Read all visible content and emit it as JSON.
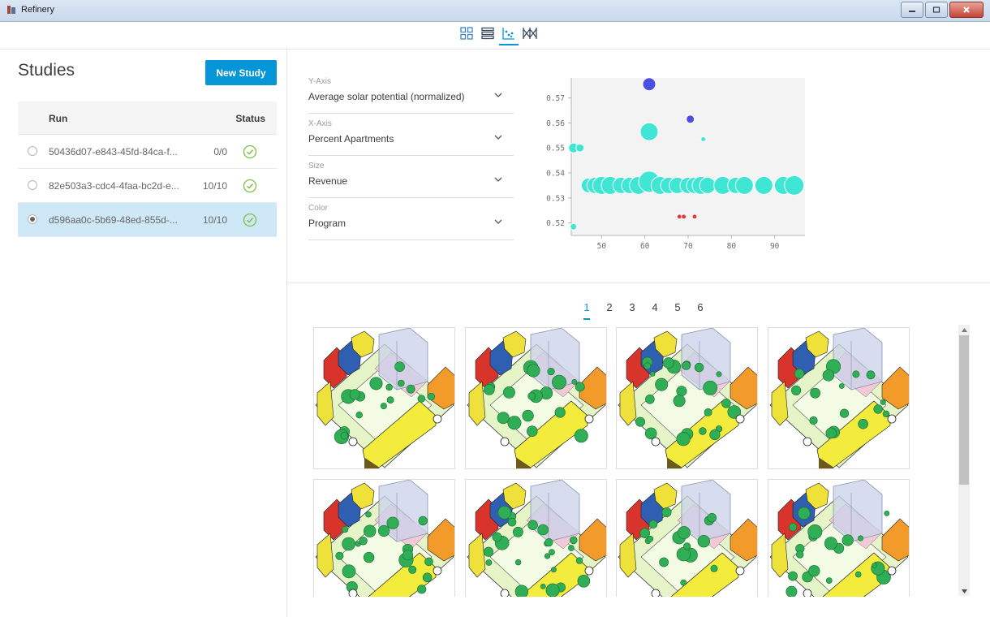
{
  "window": {
    "title": "Refinery",
    "controls": [
      "minimize",
      "maximize",
      "close"
    ]
  },
  "view_toolbar": {
    "buttons": [
      {
        "name": "grid-view-icon",
        "active": false
      },
      {
        "name": "list-view-icon",
        "active": false
      },
      {
        "name": "scatter-view-icon",
        "active": true
      },
      {
        "name": "parallel-coordinates-icon",
        "active": false
      }
    ]
  },
  "studies": {
    "title": "Studies",
    "new_study_label": "New Study",
    "columns": {
      "run": "Run",
      "status": "Status"
    },
    "rows": [
      {
        "id": "50436d07-e843-45fd-84ca-f...",
        "count": "0/0",
        "status": "complete",
        "selected": false
      },
      {
        "id": "82e503a3-cdc4-4faa-bc2d-e...",
        "count": "10/10",
        "status": "complete",
        "selected": false
      },
      {
        "id": "d596aa0c-5b69-48ed-855d-...",
        "count": "10/10",
        "status": "complete",
        "selected": true
      }
    ]
  },
  "axes": {
    "y": {
      "label": "Y-Axis",
      "value": "Average solar potential (normalized)"
    },
    "x": {
      "label": "X-Axis",
      "value": "Percent Apartments"
    },
    "size": {
      "label": "Size",
      "value": "Revenue"
    },
    "color": {
      "label": "Color",
      "value": "Program"
    }
  },
  "chart_data": {
    "type": "scatter",
    "title": "",
    "xlabel": "",
    "ylabel": "",
    "xlim": [
      43,
      97
    ],
    "ylim": [
      0.515,
      0.578
    ],
    "x_ticks": [
      50,
      60,
      70,
      80,
      90
    ],
    "y_ticks": [
      0.52,
      0.53,
      0.54,
      0.55,
      0.56,
      0.57
    ],
    "grid": false,
    "colors": {
      "teal": "#3ee6d3",
      "blue": "#4a4de6",
      "red": "#e8383d"
    },
    "points": [
      {
        "x": 61.0,
        "y": 0.5755,
        "size": 8,
        "color": "blue"
      },
      {
        "x": 70.5,
        "y": 0.5615,
        "size": 5,
        "color": "blue"
      },
      {
        "x": 61.0,
        "y": 0.5565,
        "size": 11,
        "color": "teal"
      },
      {
        "x": 73.5,
        "y": 0.5535,
        "size": 3,
        "color": "teal"
      },
      {
        "x": 43.5,
        "y": 0.55,
        "size": 6,
        "color": "teal"
      },
      {
        "x": 45.0,
        "y": 0.55,
        "size": 5,
        "color": "teal"
      },
      {
        "x": 43.5,
        "y": 0.5185,
        "size": 4,
        "color": "teal"
      },
      {
        "x": 68.0,
        "y": 0.5225,
        "size": 3,
        "color": "red"
      },
      {
        "x": 69.0,
        "y": 0.5225,
        "size": 3,
        "color": "red"
      },
      {
        "x": 71.5,
        "y": 0.5225,
        "size": 3,
        "color": "red"
      },
      {
        "x": 47.0,
        "y": 0.535,
        "size": 9,
        "color": "teal"
      },
      {
        "x": 48.5,
        "y": 0.535,
        "size": 10,
        "color": "teal"
      },
      {
        "x": 50.0,
        "y": 0.535,
        "size": 11,
        "color": "teal"
      },
      {
        "x": 52.0,
        "y": 0.535,
        "size": 11,
        "color": "teal"
      },
      {
        "x": 54.5,
        "y": 0.535,
        "size": 10,
        "color": "teal"
      },
      {
        "x": 56.5,
        "y": 0.535,
        "size": 10,
        "color": "teal"
      },
      {
        "x": 58.5,
        "y": 0.535,
        "size": 11,
        "color": "teal"
      },
      {
        "x": 61.0,
        "y": 0.5365,
        "size": 13,
        "color": "teal"
      },
      {
        "x": 63.5,
        "y": 0.535,
        "size": 11,
        "color": "teal"
      },
      {
        "x": 65.5,
        "y": 0.535,
        "size": 10,
        "color": "teal"
      },
      {
        "x": 67.5,
        "y": 0.535,
        "size": 10,
        "color": "teal"
      },
      {
        "x": 70.0,
        "y": 0.535,
        "size": 10,
        "color": "teal"
      },
      {
        "x": 71.5,
        "y": 0.535,
        "size": 10,
        "color": "teal"
      },
      {
        "x": 73.0,
        "y": 0.535,
        "size": 11,
        "color": "teal"
      },
      {
        "x": 74.5,
        "y": 0.535,
        "size": 10,
        "color": "teal"
      },
      {
        "x": 78.0,
        "y": 0.535,
        "size": 11,
        "color": "teal"
      },
      {
        "x": 81.0,
        "y": 0.535,
        "size": 10,
        "color": "teal"
      },
      {
        "x": 83.0,
        "y": 0.535,
        "size": 11,
        "color": "teal"
      },
      {
        "x": 87.5,
        "y": 0.535,
        "size": 11,
        "color": "teal"
      },
      {
        "x": 92.0,
        "y": 0.535,
        "size": 11,
        "color": "teal"
      },
      {
        "x": 94.5,
        "y": 0.535,
        "size": 12,
        "color": "teal"
      }
    ]
  },
  "pagination": {
    "pages": [
      "1",
      "2",
      "3",
      "4",
      "5",
      "6"
    ],
    "active": "1"
  }
}
